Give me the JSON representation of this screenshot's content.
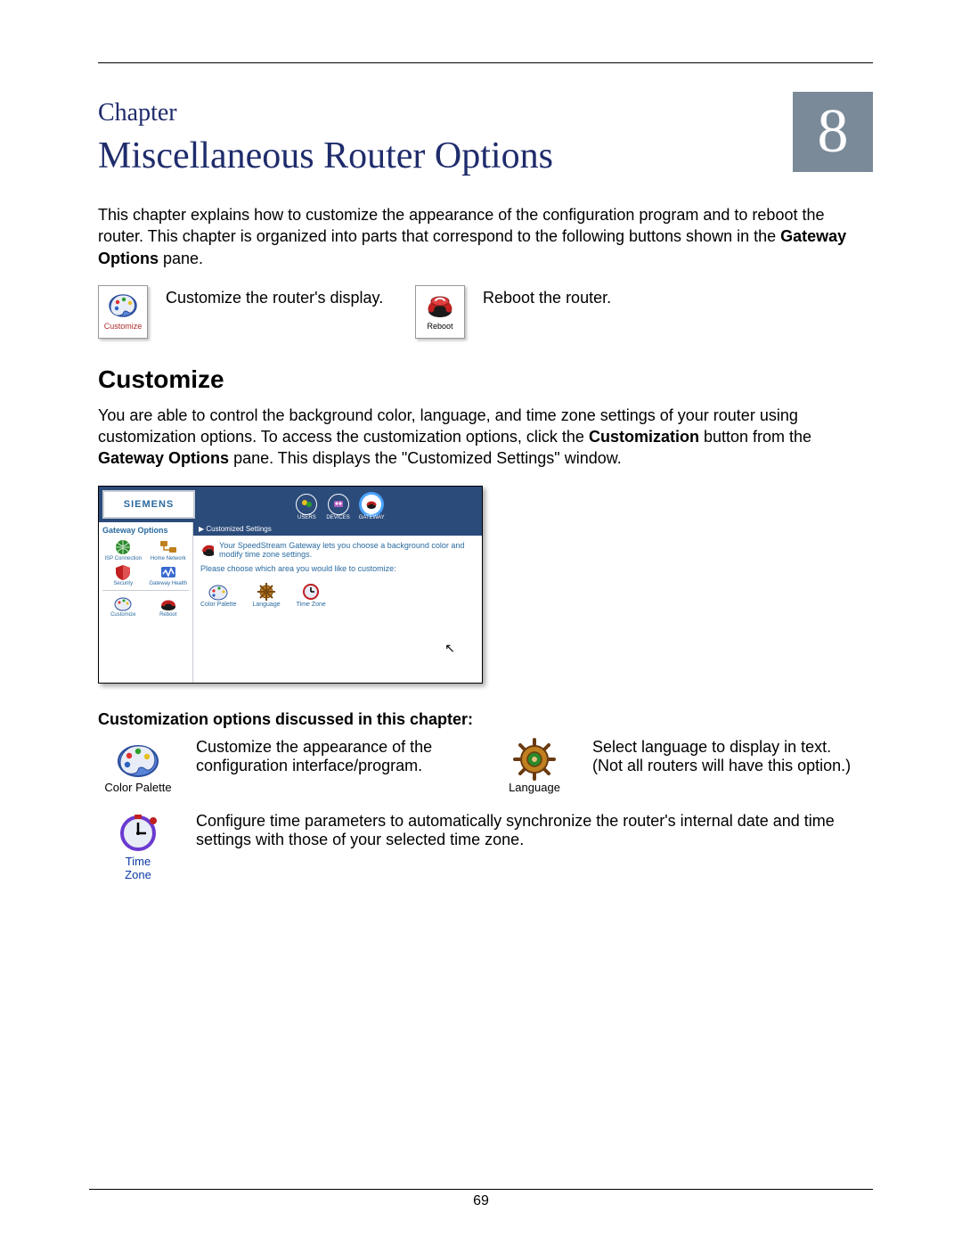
{
  "chapter": {
    "label": "Chapter",
    "number": "8",
    "title": "Miscellaneous Router Options"
  },
  "intro": {
    "p1_pre": "This chapter explains how to customize the appearance of the configuration program and to reboot the router. This chapter is organized into parts that correspond to the following buttons shown in the ",
    "p1_bold": "Gateway Options",
    "p1_post": " pane."
  },
  "buttons_row": {
    "customize_caption": "Customize",
    "customize_desc": "Customize the router's display.",
    "reboot_caption": "Reboot",
    "reboot_desc": "Reboot the router."
  },
  "section": {
    "heading": "Customize",
    "p_pre": "You are able to control the background color, language, and time zone settings of your router using customization options. To access the customization options, click the ",
    "p_bold1": "Customization",
    "p_mid": " button from the ",
    "p_bold2": "Gateway Options",
    "p_post": " pane. This displays the \"Customized Settings\" window."
  },
  "screenshot": {
    "brand": "SIEMENS",
    "tabs": {
      "users": "USERS",
      "devices": "DEVICES",
      "gateway": "GATEWAY"
    },
    "side": {
      "title": "Gateway Options",
      "items": {
        "isp": "ISP Connection",
        "home": "Home Network",
        "security": "Security",
        "health": "Gateway Health",
        "customize": "Customize",
        "reboot": "Reboot"
      }
    },
    "main": {
      "bar": "Customized Settings",
      "desc": "Your SpeedStream Gateway lets you choose a background color and modify time zone settings.",
      "sub": "Please choose which area you would like to customize:",
      "icons": {
        "palette": "Color Palette",
        "language": "Language",
        "time": "Time Zone"
      }
    }
  },
  "subsection": {
    "label": "Customization options discussed in this chapter:",
    "palette": {
      "caption": "Color Palette",
      "desc": "Customize the appearance of the configuration interface/program."
    },
    "language": {
      "caption": "Language",
      "desc_l1": "Select language to display in text.",
      "desc_l2": "(Not all routers will have this option.)"
    },
    "timezone": {
      "caption_l1": "Time",
      "caption_l2": "Zone",
      "desc": "Configure time parameters to automatically synchronize the router's internal date and time settings with those of your selected time zone."
    }
  },
  "page_number": "69"
}
